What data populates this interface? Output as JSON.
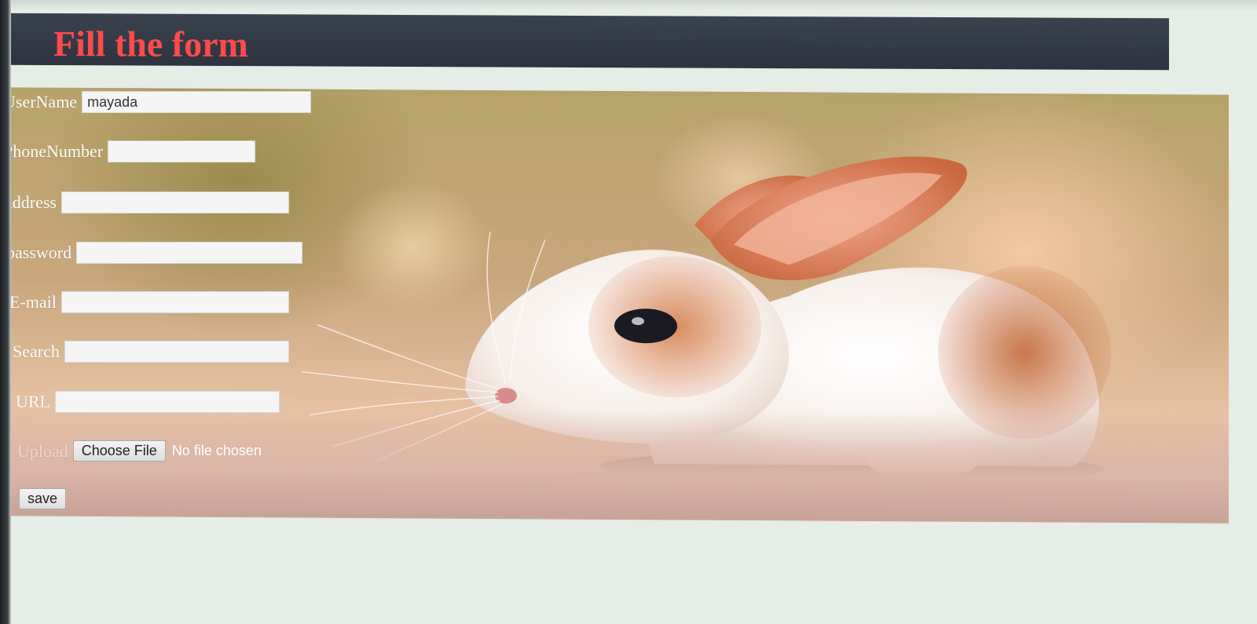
{
  "page": {
    "title": "Fill the form"
  },
  "form": {
    "username": {
      "label": "UserName",
      "value": "mayada"
    },
    "phone": {
      "label": "PhoneNumber",
      "value": ""
    },
    "address": {
      "label": "address",
      "value": ""
    },
    "password": {
      "label": "password",
      "value": ""
    },
    "email": {
      "label": "E-mail",
      "value": ""
    },
    "search": {
      "label": "Search",
      "value": ""
    },
    "url": {
      "label": "URL",
      "value": ""
    },
    "upload": {
      "label": "Upload",
      "button": "Choose File",
      "status": "No file chosen"
    },
    "save_label": "save"
  },
  "colors": {
    "title": "#ff4b4b",
    "header_bar": "#2d3440",
    "page_background": "#e6ece6"
  },
  "background_image": {
    "subject": "bunny-photo"
  }
}
